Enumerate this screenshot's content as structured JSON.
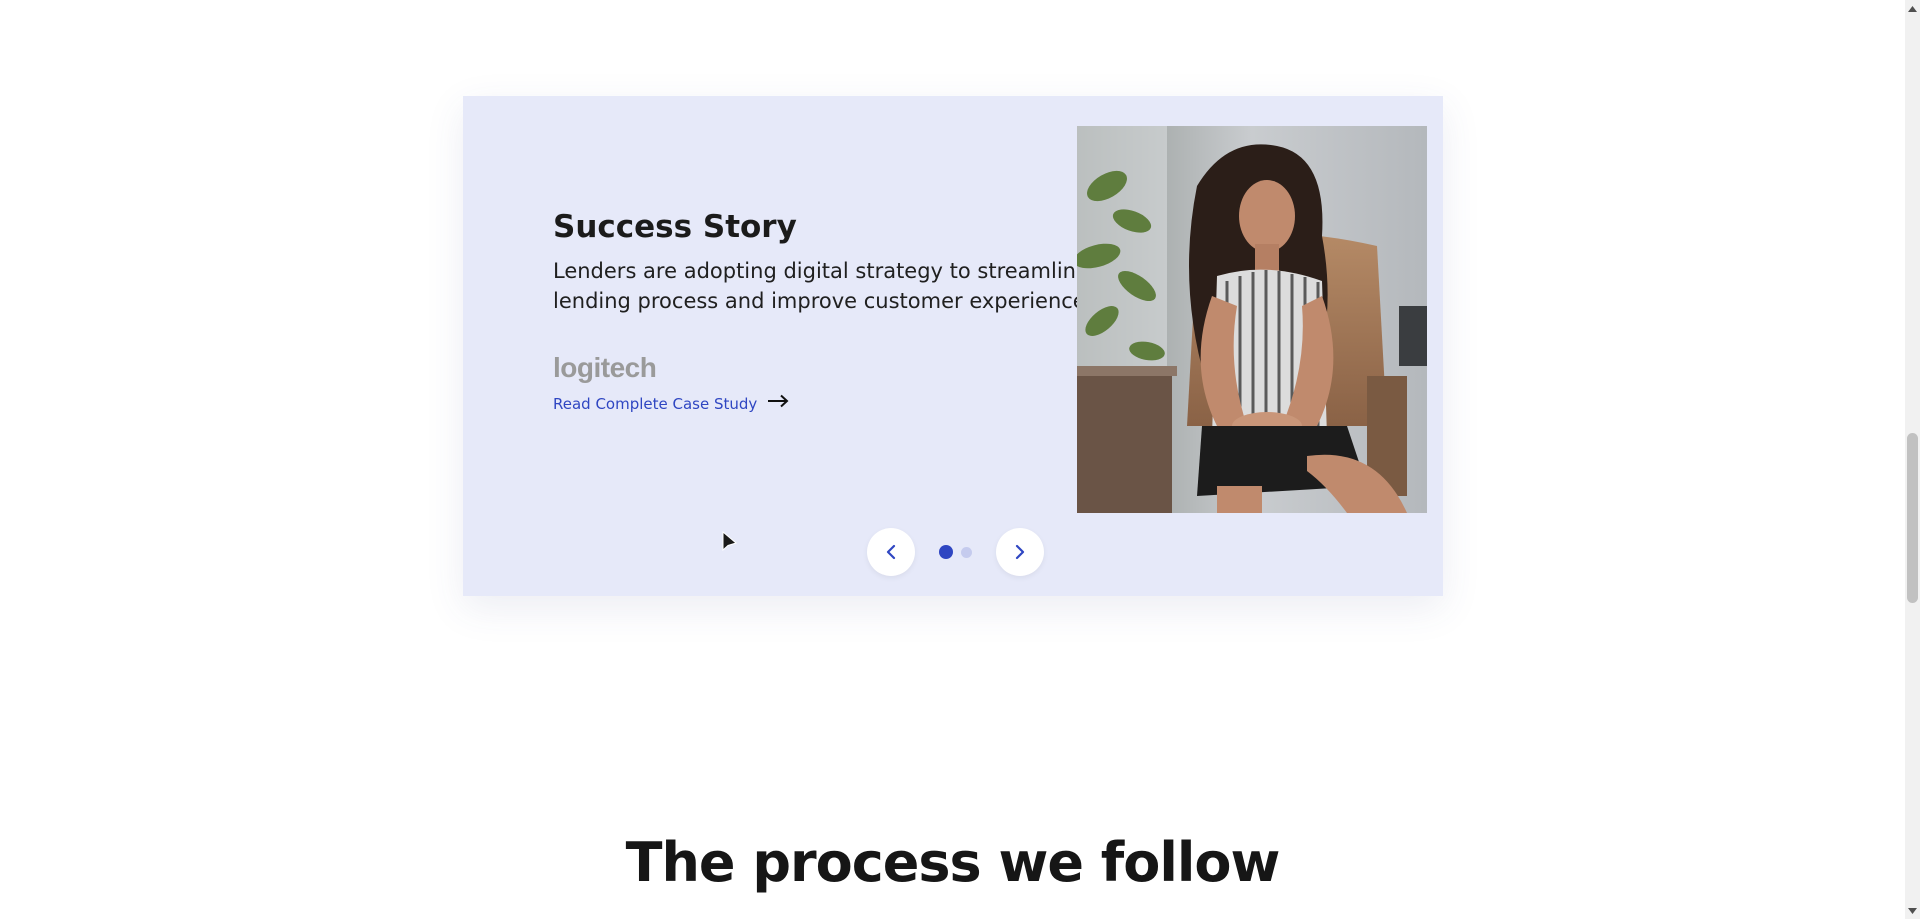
{
  "case_study": {
    "title": "Success Story",
    "description": "Lenders are adopting digital strategy to streamline lending process and improve customer experience.",
    "client_logo": "logitech",
    "link_label": "Read Complete Case Study",
    "link_icon": "arrow-right-icon",
    "photo": "woman-seated-office-chair-photo"
  },
  "carousel": {
    "prev_icon": "chevron-left-icon",
    "next_icon": "chevron-right-icon",
    "slide_count": 2,
    "active_index": 0
  },
  "process": {
    "title": "The process we follow"
  },
  "colors": {
    "card_background": "#e6e9f9",
    "accent": "#2f46c2",
    "dot_inactive": "#c5cbee",
    "heading": "#161616"
  }
}
